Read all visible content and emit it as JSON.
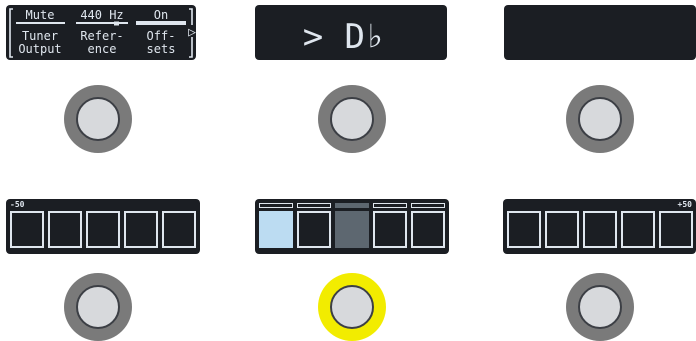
{
  "screen_left": {
    "columns": [
      {
        "value": "Mute",
        "label_line1": "Tuner",
        "label_line2": "Output"
      },
      {
        "value": "440 Hz",
        "label_line1": "Refer-",
        "label_line2": "ence"
      },
      {
        "value": "On",
        "label_line1": "Off-",
        "label_line2": "sets"
      }
    ],
    "page_arrow": "▷"
  },
  "screen_center": {
    "prefix": ">",
    "note": "D♭"
  },
  "screen_right": {
    "text": ""
  },
  "meter_left": {
    "scale_label": "-50",
    "cells": 5
  },
  "meter_center": {
    "cells": 5,
    "highlighted_cell_index": 2,
    "lit_cell_index": 0
  },
  "meter_right": {
    "scale_label": "+50",
    "cells": 5
  },
  "colors": {
    "panel": "#1b1e23",
    "lcd_text": "#dfe6ee",
    "active_switch": "#f2ec00",
    "lit_cell": "#bcdcf2",
    "highlight_cell": "#5d6770"
  },
  "footswitches": {
    "active_index": 4
  }
}
